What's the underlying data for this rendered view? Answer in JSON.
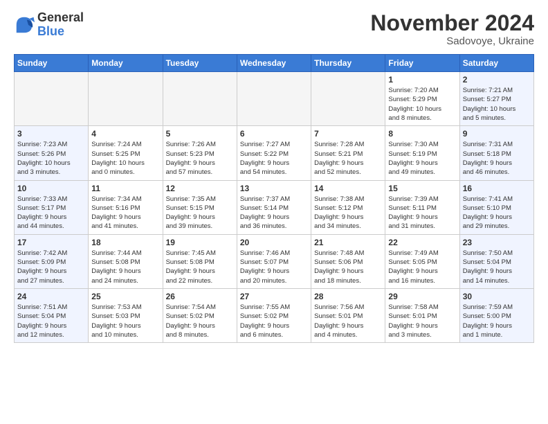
{
  "logo": {
    "general": "General",
    "blue": "Blue"
  },
  "title": "November 2024",
  "subtitle": "Sadovoye, Ukraine",
  "days_header": [
    "Sunday",
    "Monday",
    "Tuesday",
    "Wednesday",
    "Thursday",
    "Friday",
    "Saturday"
  ],
  "weeks": [
    [
      {
        "day": "",
        "info": "",
        "empty": true
      },
      {
        "day": "",
        "info": "",
        "empty": true
      },
      {
        "day": "",
        "info": "",
        "empty": true
      },
      {
        "day": "",
        "info": "",
        "empty": true
      },
      {
        "day": "",
        "info": "",
        "empty": true
      },
      {
        "day": "1",
        "info": "Sunrise: 7:20 AM\nSunset: 5:29 PM\nDaylight: 10 hours\nand 8 minutes.",
        "empty": false,
        "weekend": true
      },
      {
        "day": "2",
        "info": "Sunrise: 7:21 AM\nSunset: 5:27 PM\nDaylight: 10 hours\nand 5 minutes.",
        "empty": false,
        "weekend": true
      }
    ],
    [
      {
        "day": "3",
        "info": "Sunrise: 7:23 AM\nSunset: 5:26 PM\nDaylight: 10 hours\nand 3 minutes.",
        "empty": false,
        "weekend": true
      },
      {
        "day": "4",
        "info": "Sunrise: 7:24 AM\nSunset: 5:25 PM\nDaylight: 10 hours\nand 0 minutes.",
        "empty": false,
        "weekend": false
      },
      {
        "day": "5",
        "info": "Sunrise: 7:26 AM\nSunset: 5:23 PM\nDaylight: 9 hours\nand 57 minutes.",
        "empty": false,
        "weekend": false
      },
      {
        "day": "6",
        "info": "Sunrise: 7:27 AM\nSunset: 5:22 PM\nDaylight: 9 hours\nand 54 minutes.",
        "empty": false,
        "weekend": false
      },
      {
        "day": "7",
        "info": "Sunrise: 7:28 AM\nSunset: 5:21 PM\nDaylight: 9 hours\nand 52 minutes.",
        "empty": false,
        "weekend": false
      },
      {
        "day": "8",
        "info": "Sunrise: 7:30 AM\nSunset: 5:19 PM\nDaylight: 9 hours\nand 49 minutes.",
        "empty": false,
        "weekend": true
      },
      {
        "day": "9",
        "info": "Sunrise: 7:31 AM\nSunset: 5:18 PM\nDaylight: 9 hours\nand 46 minutes.",
        "empty": false,
        "weekend": true
      }
    ],
    [
      {
        "day": "10",
        "info": "Sunrise: 7:33 AM\nSunset: 5:17 PM\nDaylight: 9 hours\nand 44 minutes.",
        "empty": false,
        "weekend": true
      },
      {
        "day": "11",
        "info": "Sunrise: 7:34 AM\nSunset: 5:16 PM\nDaylight: 9 hours\nand 41 minutes.",
        "empty": false,
        "weekend": false
      },
      {
        "day": "12",
        "info": "Sunrise: 7:35 AM\nSunset: 5:15 PM\nDaylight: 9 hours\nand 39 minutes.",
        "empty": false,
        "weekend": false
      },
      {
        "day": "13",
        "info": "Sunrise: 7:37 AM\nSunset: 5:14 PM\nDaylight: 9 hours\nand 36 minutes.",
        "empty": false,
        "weekend": false
      },
      {
        "day": "14",
        "info": "Sunrise: 7:38 AM\nSunset: 5:12 PM\nDaylight: 9 hours\nand 34 minutes.",
        "empty": false,
        "weekend": false
      },
      {
        "day": "15",
        "info": "Sunrise: 7:39 AM\nSunset: 5:11 PM\nDaylight: 9 hours\nand 31 minutes.",
        "empty": false,
        "weekend": true
      },
      {
        "day": "16",
        "info": "Sunrise: 7:41 AM\nSunset: 5:10 PM\nDaylight: 9 hours\nand 29 minutes.",
        "empty": false,
        "weekend": true
      }
    ],
    [
      {
        "day": "17",
        "info": "Sunrise: 7:42 AM\nSunset: 5:09 PM\nDaylight: 9 hours\nand 27 minutes.",
        "empty": false,
        "weekend": true
      },
      {
        "day": "18",
        "info": "Sunrise: 7:44 AM\nSunset: 5:08 PM\nDaylight: 9 hours\nand 24 minutes.",
        "empty": false,
        "weekend": false
      },
      {
        "day": "19",
        "info": "Sunrise: 7:45 AM\nSunset: 5:08 PM\nDaylight: 9 hours\nand 22 minutes.",
        "empty": false,
        "weekend": false
      },
      {
        "day": "20",
        "info": "Sunrise: 7:46 AM\nSunset: 5:07 PM\nDaylight: 9 hours\nand 20 minutes.",
        "empty": false,
        "weekend": false
      },
      {
        "day": "21",
        "info": "Sunrise: 7:48 AM\nSunset: 5:06 PM\nDaylight: 9 hours\nand 18 minutes.",
        "empty": false,
        "weekend": false
      },
      {
        "day": "22",
        "info": "Sunrise: 7:49 AM\nSunset: 5:05 PM\nDaylight: 9 hours\nand 16 minutes.",
        "empty": false,
        "weekend": true
      },
      {
        "day": "23",
        "info": "Sunrise: 7:50 AM\nSunset: 5:04 PM\nDaylight: 9 hours\nand 14 minutes.",
        "empty": false,
        "weekend": true
      }
    ],
    [
      {
        "day": "24",
        "info": "Sunrise: 7:51 AM\nSunset: 5:04 PM\nDaylight: 9 hours\nand 12 minutes.",
        "empty": false,
        "weekend": true
      },
      {
        "day": "25",
        "info": "Sunrise: 7:53 AM\nSunset: 5:03 PM\nDaylight: 9 hours\nand 10 minutes.",
        "empty": false,
        "weekend": false
      },
      {
        "day": "26",
        "info": "Sunrise: 7:54 AM\nSunset: 5:02 PM\nDaylight: 9 hours\nand 8 minutes.",
        "empty": false,
        "weekend": false
      },
      {
        "day": "27",
        "info": "Sunrise: 7:55 AM\nSunset: 5:02 PM\nDaylight: 9 hours\nand 6 minutes.",
        "empty": false,
        "weekend": false
      },
      {
        "day": "28",
        "info": "Sunrise: 7:56 AM\nSunset: 5:01 PM\nDaylight: 9 hours\nand 4 minutes.",
        "empty": false,
        "weekend": false
      },
      {
        "day": "29",
        "info": "Sunrise: 7:58 AM\nSunset: 5:01 PM\nDaylight: 9 hours\nand 3 minutes.",
        "empty": false,
        "weekend": true
      },
      {
        "day": "30",
        "info": "Sunrise: 7:59 AM\nSunset: 5:00 PM\nDaylight: 9 hours\nand 1 minute.",
        "empty": false,
        "weekend": true
      }
    ]
  ]
}
